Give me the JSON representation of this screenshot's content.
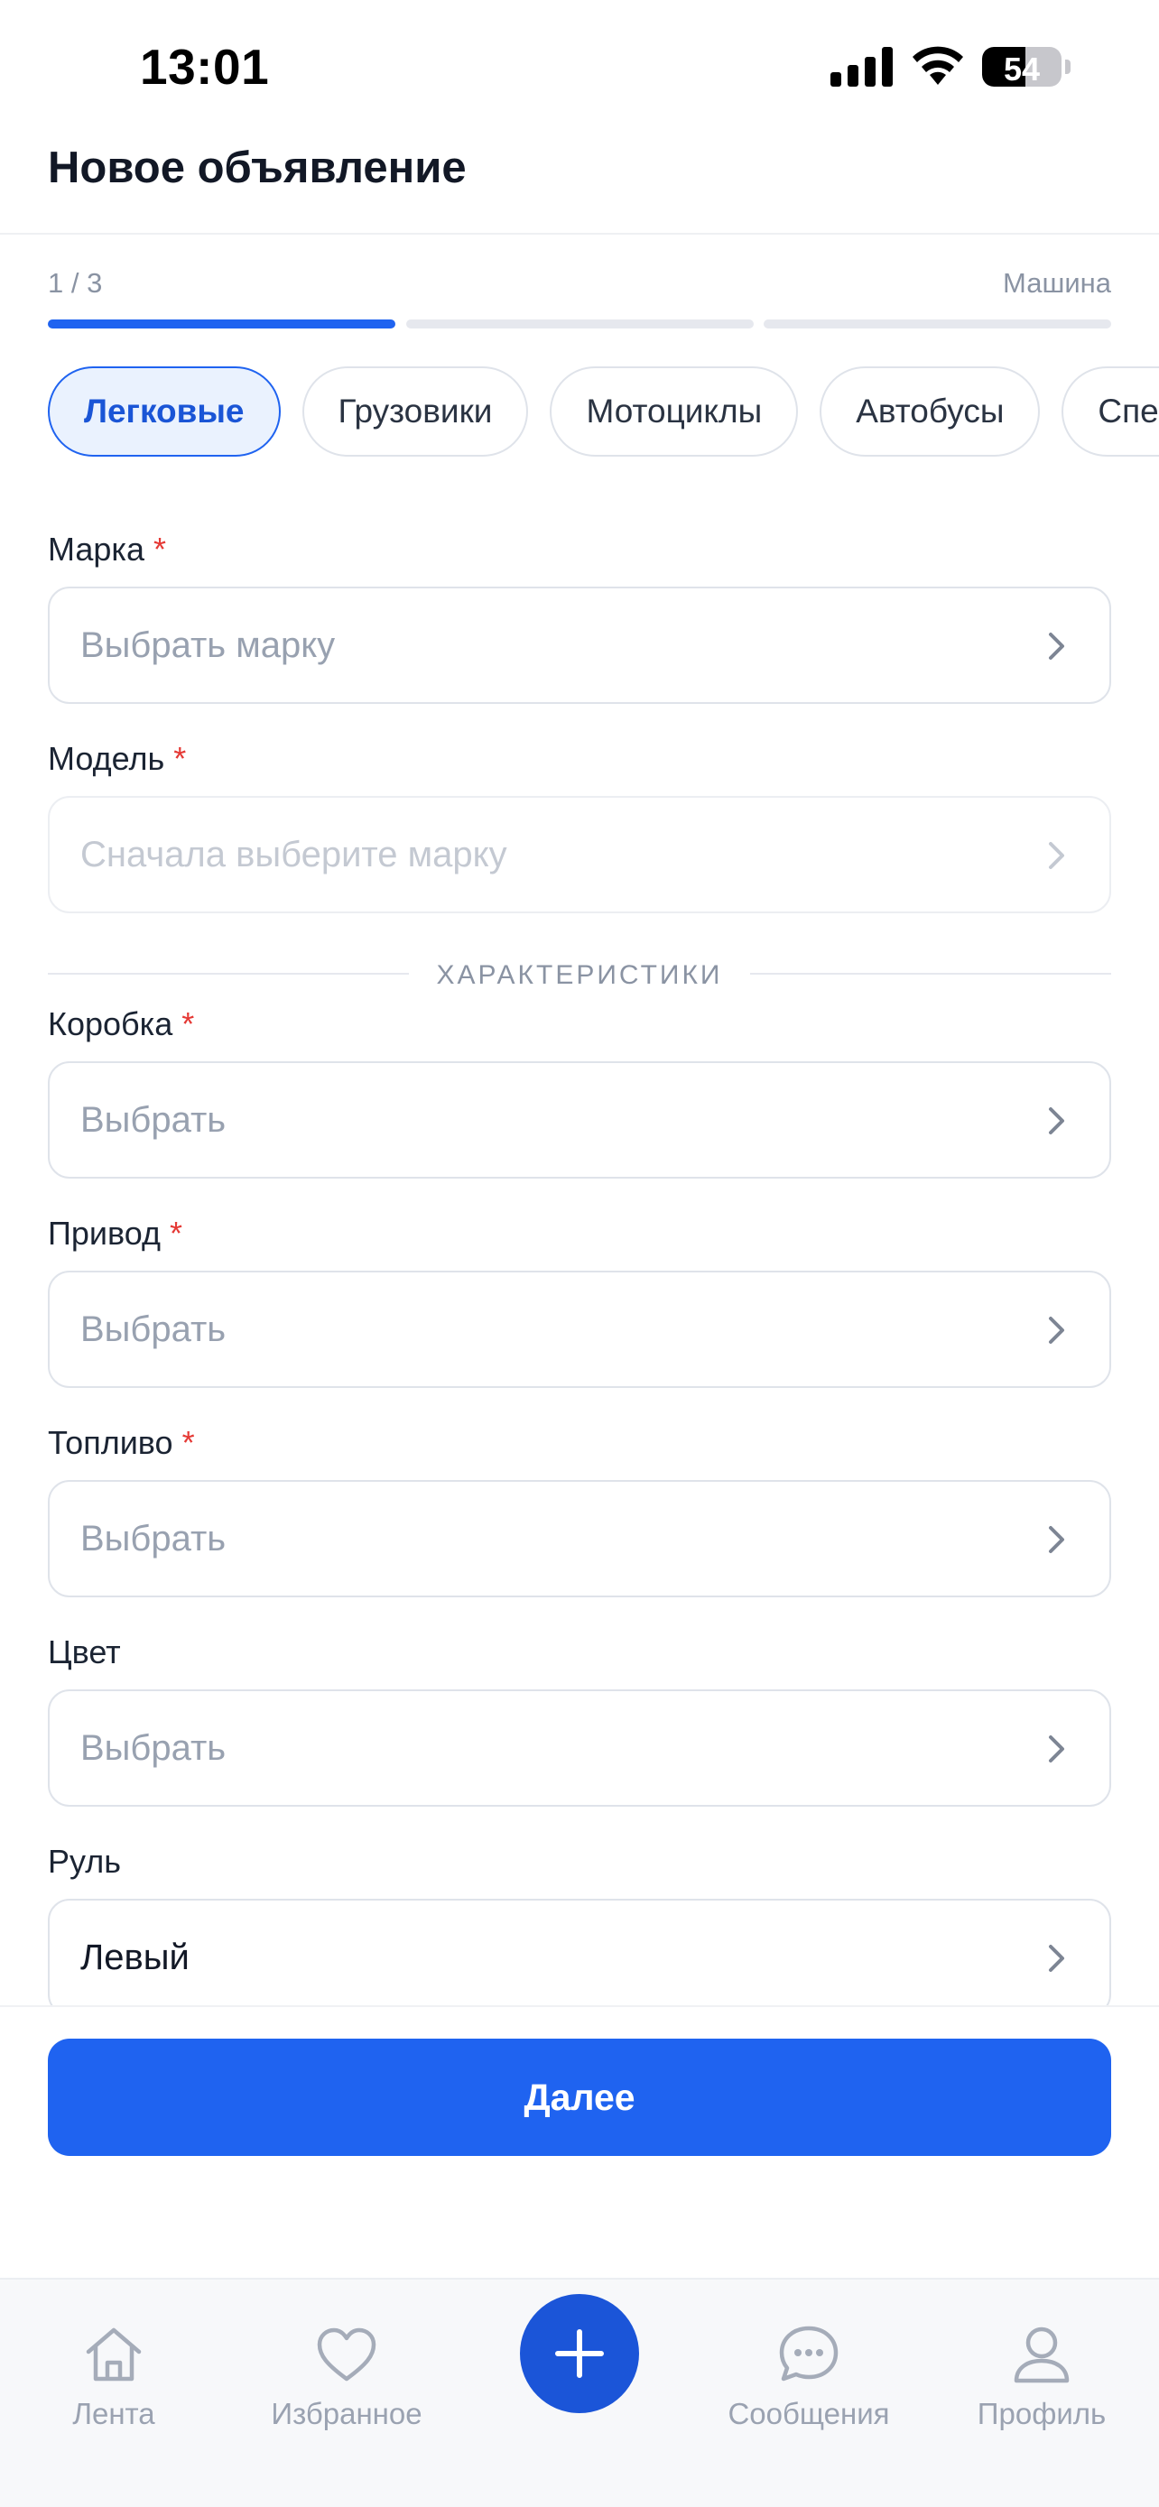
{
  "status_bar": {
    "time": "13:01",
    "battery": "54",
    "battery_level": 0.54
  },
  "header": {
    "title": "Новое объявление"
  },
  "progress": {
    "step": "1 / 3",
    "step_name": "Машина",
    "total_steps": 3,
    "current_step": 1
  },
  "categories": {
    "items": [
      "Легковые",
      "Грузовики",
      "Мотоциклы",
      "Автобусы",
      "Спецтехника"
    ],
    "selected": "Легковые"
  },
  "fields": {
    "brand": {
      "label": "Марка",
      "required_mark": "*",
      "placeholder": "Выбрать марку"
    },
    "model": {
      "label": "Модель",
      "required_mark": "*",
      "placeholder": "Сначала выберите марку"
    },
    "gearbox": {
      "label": "Коробка",
      "required_mark": "*",
      "placeholder": "Выбрать"
    },
    "drive": {
      "label": "Привод",
      "required_mark": "*",
      "placeholder": "Выбрать"
    },
    "fuel": {
      "label": "Топливо",
      "required_mark": "*",
      "placeholder": "Выбрать"
    },
    "color": {
      "label": "Цвет",
      "placeholder": "Выбрать"
    },
    "steering": {
      "label": "Руль",
      "value": "Левый"
    }
  },
  "section": {
    "title": "ХАРАКТЕРИСТИКИ"
  },
  "actions": {
    "next_label": "Далее"
  },
  "tabbar": {
    "feed": {
      "label": "Лента",
      "icon": "home-icon"
    },
    "favorites": {
      "label": "Избранное",
      "icon": "heart-icon"
    },
    "add": {
      "icon": "plus-icon"
    },
    "messages": {
      "label": "Сообщения",
      "icon": "chat-bubble-icon"
    },
    "profile": {
      "label": "Профиль",
      "icon": "user-icon"
    }
  },
  "colors": {
    "accent": "#1f63f0",
    "required": "#e53935",
    "muted": "#8a93a3"
  }
}
